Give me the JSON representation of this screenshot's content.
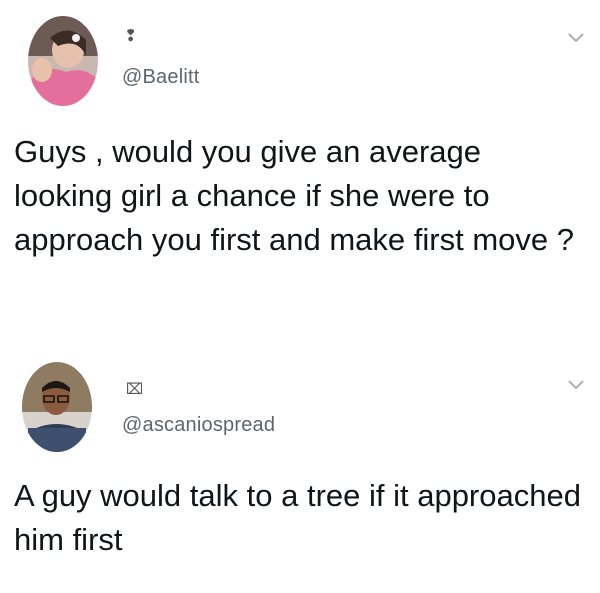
{
  "tweets": [
    {
      "name_glyph": "❢",
      "handle": "@Baelitt",
      "text": "Guys , would you give an average looking girl a chance if she were to approach you first and make first move ?",
      "avatar_icon": "profile-photo-woman"
    },
    {
      "name_glyph": "⌧",
      "handle": "@ascaniospread",
      "text": "A guy would talk to a tree if it approached him first",
      "avatar_icon": "profile-photo-man"
    }
  ],
  "colors": {
    "handle": "#5b6670",
    "text": "#111418",
    "chevron": "#a7b0b8"
  }
}
